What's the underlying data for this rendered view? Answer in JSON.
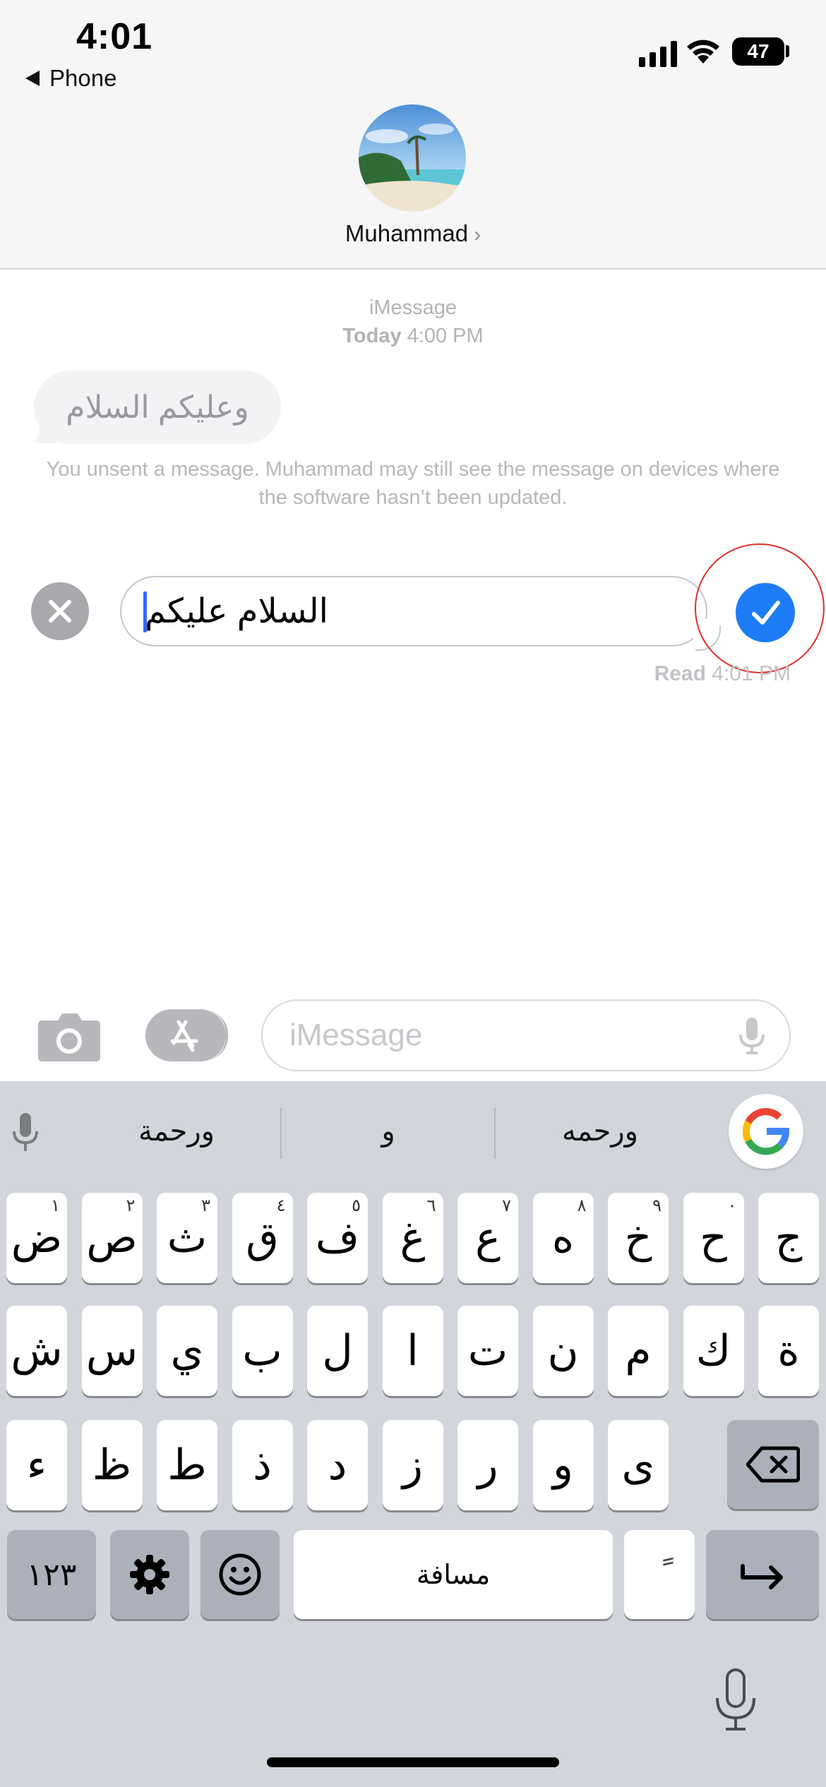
{
  "status_bar": {
    "time": "4:01",
    "back_label": "Phone",
    "battery": "47"
  },
  "header": {
    "contact_name": "Muhammad",
    "chevron": "›"
  },
  "conversation": {
    "service": "iMessage",
    "timestamp_day": "Today",
    "timestamp_time": "4:00 PM",
    "incoming_message": "وعليكم السلام",
    "unsent_note": "You unsent a message. Muhammad may still see the message on devices where the software hasn’t been updated.",
    "editing_text": "السلام عليكم",
    "read_label": "Read",
    "read_time": "4:01 PM"
  },
  "input_bar": {
    "placeholder": "iMessage"
  },
  "keyboard": {
    "suggestions": [
      "ورحمه",
      "و",
      "ورحمة"
    ],
    "row1": [
      {
        "k": "ج",
        "n": ""
      },
      {
        "k": "ح",
        "n": "٠"
      },
      {
        "k": "خ",
        "n": "٩"
      },
      {
        "k": "ه",
        "n": "٨"
      },
      {
        "k": "ع",
        "n": "٧"
      },
      {
        "k": "غ",
        "n": "٦"
      },
      {
        "k": "ف",
        "n": "٥"
      },
      {
        "k": "ق",
        "n": "٤"
      },
      {
        "k": "ث",
        "n": "٣"
      },
      {
        "k": "ص",
        "n": "٢"
      },
      {
        "k": "ض",
        "n": "١"
      }
    ],
    "row2": [
      "ة",
      "ك",
      "م",
      "ن",
      "ت",
      "ا",
      "ل",
      "ب",
      "ي",
      "س",
      "ش"
    ],
    "row3": [
      "ى",
      "و",
      "ر",
      "ز",
      "د",
      "ذ",
      "ط",
      "ظ",
      "ء"
    ],
    "numbers_label": "١٢٣",
    "space_label": "مسافة",
    "diacritic_label": "ً"
  },
  "colors": {
    "accent": "#1f7cf7",
    "highlight_ring": "#d9302a",
    "keyboard_bg": "#d2d5db"
  }
}
